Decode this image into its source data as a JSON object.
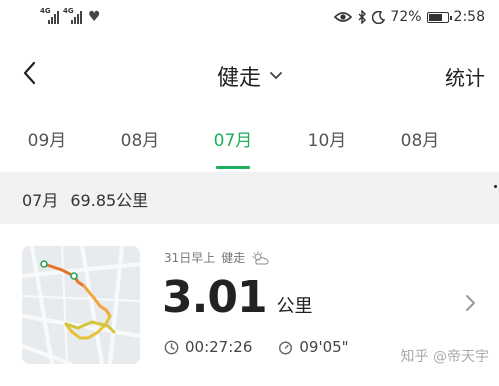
{
  "status_bar": {
    "signal1_label": "4G",
    "signal2_label": "4G",
    "battery": "72%",
    "battery_level": 0.72,
    "time": "2:58"
  },
  "header": {
    "title": "健走",
    "right_action": "统计"
  },
  "tabs": [
    {
      "label": "09月",
      "active": false
    },
    {
      "label": "08月",
      "active": false
    },
    {
      "label": "07月",
      "active": true
    },
    {
      "label": "10月",
      "active": false
    },
    {
      "label": "08月",
      "active": false
    }
  ],
  "summary": {
    "month": "07月",
    "distance": "69.85公里"
  },
  "workout": {
    "date": "31日早上",
    "type": "健走",
    "distance": "3.01",
    "unit": "公里",
    "duration": "00:27:26",
    "pace": "09'05\""
  },
  "watermark": "知乎 @帝天宇",
  "colors": {
    "accent": "#1fae5c",
    "route_start": "#e8742c",
    "route_mid": "#f2b33a",
    "route_end": "#d6c53a"
  },
  "icons": {
    "back": "chevron-left-icon",
    "title_dropdown": "chevron-down-icon",
    "weather": "partly-cloudy-icon",
    "duration": "clock-icon",
    "pace": "stopwatch-icon",
    "go": "chevron-right-icon"
  }
}
